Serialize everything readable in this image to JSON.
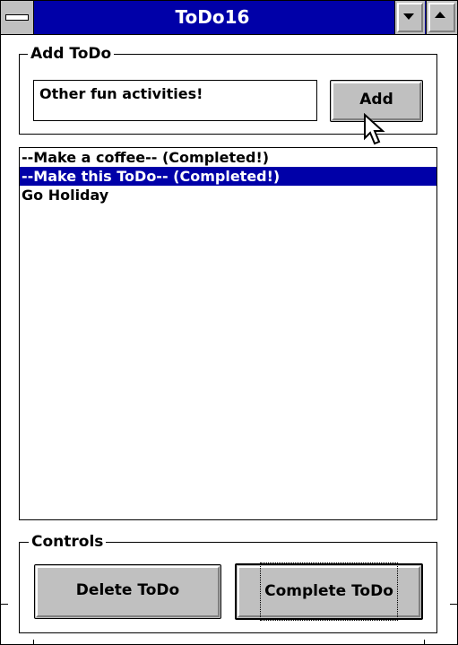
{
  "window": {
    "title": "ToDo16"
  },
  "add_group": {
    "label": "Add ToDo",
    "input_value": "Other fun activities!",
    "add_button_label": "Add"
  },
  "todo_list": {
    "items": [
      {
        "text": "--Make a coffee-- (Completed!)",
        "selected": false
      },
      {
        "text": "--Make this ToDo-- (Completed!)",
        "selected": true
      },
      {
        "text": "Go Holiday",
        "selected": false
      }
    ]
  },
  "controls_group": {
    "label": "Controls",
    "delete_button_label": "Delete ToDo",
    "complete_button_label": "Complete ToDo"
  },
  "colors": {
    "title_bar": "#0000a8",
    "selection": "#0000a8",
    "button_face": "#c0c0c0"
  },
  "icons": {
    "system_menu": "system-menu-icon",
    "minimize": "minimize-icon",
    "maximize": "maximize-icon",
    "cursor": "mouse-pointer-icon"
  }
}
